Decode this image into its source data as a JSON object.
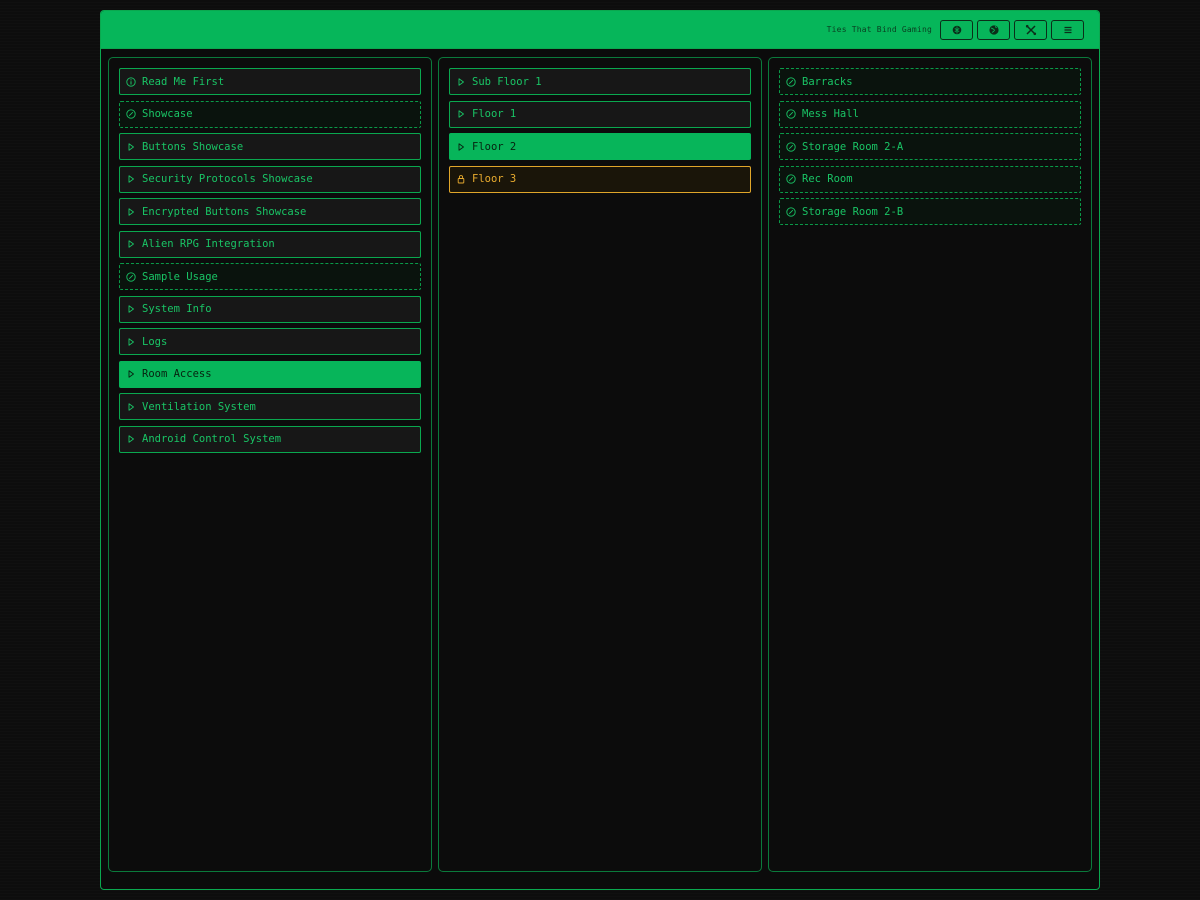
{
  "header": {
    "brand": "Ties That Bind Gaming",
    "buttons": [
      {
        "icon": "brain-icon"
      },
      {
        "icon": "globe-icon"
      },
      {
        "icon": "tools-icon"
      },
      {
        "icon": "menu-icon"
      }
    ]
  },
  "colors": {
    "accent": "#06b65a",
    "text": "#19c465",
    "locked": "#e8ab2e",
    "background": "#0b0b0b"
  },
  "left_menu": {
    "items": [
      {
        "label": "Read Me First",
        "icon": "info-icon"
      },
      {
        "label": "Showcase",
        "icon": "check-circle-icon"
      },
      {
        "label": "Buttons Showcase",
        "icon": "play-icon"
      },
      {
        "label": "Security Protocols Showcase",
        "icon": "play-icon"
      },
      {
        "label": "Encrypted Buttons Showcase",
        "icon": "play-icon"
      },
      {
        "label": "Alien RPG Integration",
        "icon": "play-icon"
      },
      {
        "label": "Sample Usage",
        "icon": "check-circle-icon"
      },
      {
        "label": "System Info",
        "icon": "play-icon"
      },
      {
        "label": "Logs",
        "icon": "play-icon"
      },
      {
        "label": "Room Access",
        "icon": "play-icon",
        "state": "active"
      },
      {
        "label": "Ventilation System",
        "icon": "play-icon"
      },
      {
        "label": "Android Control System",
        "icon": "play-icon"
      }
    ]
  },
  "floors": {
    "items": [
      {
        "label": "Sub Floor 1",
        "icon": "play-icon"
      },
      {
        "label": "Floor 1",
        "icon": "play-icon"
      },
      {
        "label": "Floor 2",
        "icon": "play-icon",
        "state": "active"
      },
      {
        "label": "Floor 3",
        "icon": "lock-icon",
        "state": "locked"
      }
    ]
  },
  "rooms": {
    "items": [
      {
        "label": "Barracks",
        "icon": "check-circle-icon"
      },
      {
        "label": "Mess Hall",
        "icon": "check-circle-icon"
      },
      {
        "label": "Storage Room 2-A",
        "icon": "check-circle-icon"
      },
      {
        "label": "Rec Room",
        "icon": "check-circle-icon"
      },
      {
        "label": "Storage Room 2-B",
        "icon": "check-circle-icon"
      }
    ]
  }
}
